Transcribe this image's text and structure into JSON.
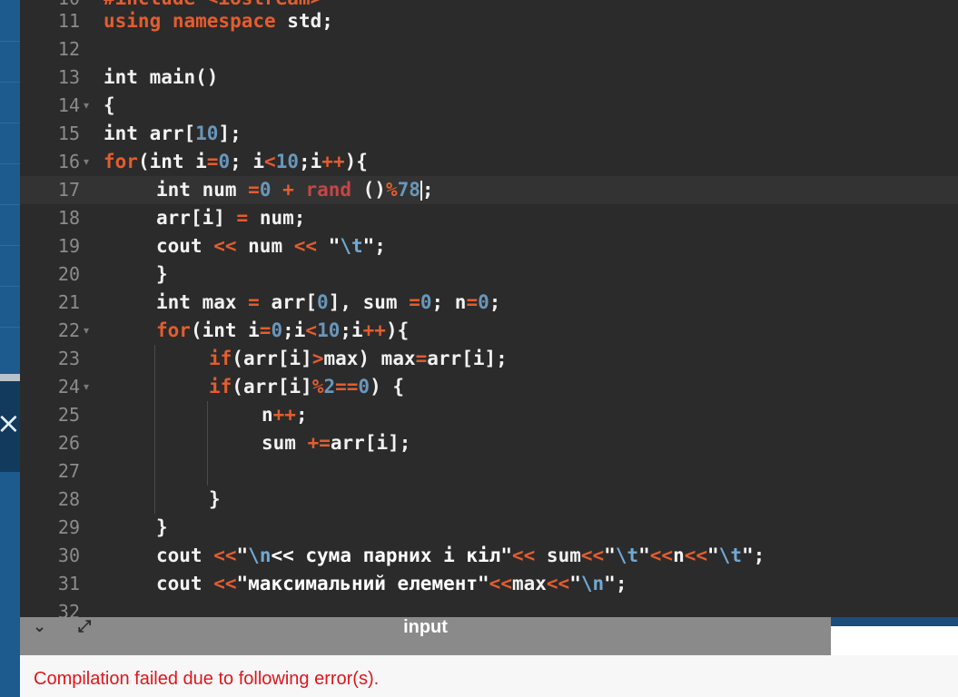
{
  "editor": {
    "top_partial_text": "#include <iostream>",
    "lines": [
      {
        "n": "11",
        "fold": "",
        "indent": 0,
        "tokens": [
          [
            "kw",
            "using namespace"
          ],
          [
            "id",
            " std;"
          ]
        ]
      },
      {
        "n": "12",
        "fold": "",
        "indent": 0,
        "tokens": []
      },
      {
        "n": "13",
        "fold": "",
        "indent": 0,
        "tokens": [
          [
            "id",
            "int main()"
          ]
        ]
      },
      {
        "n": "14",
        "fold": "▾",
        "indent": 0,
        "tokens": [
          [
            "id",
            "{"
          ]
        ]
      },
      {
        "n": "15",
        "fold": "",
        "indent": 0,
        "tokens": [
          [
            "id",
            "int arr["
          ],
          [
            "num",
            "10"
          ],
          [
            "id",
            "];"
          ]
        ]
      },
      {
        "n": "16",
        "fold": "▾",
        "indent": 0,
        "tokens": [
          [
            "kw",
            "for"
          ],
          [
            "id",
            "(int i"
          ],
          [
            "op",
            "="
          ],
          [
            "num",
            "0"
          ],
          [
            "id",
            "; i"
          ],
          [
            "op",
            "<"
          ],
          [
            "num",
            "10"
          ],
          [
            "id",
            ";i"
          ],
          [
            "op",
            "++"
          ],
          [
            "id",
            "){"
          ]
        ]
      },
      {
        "n": "17",
        "fold": "",
        "indent": 1,
        "active": true,
        "tokens": [
          [
            "id",
            "int num "
          ],
          [
            "op",
            "="
          ],
          [
            "num",
            "0"
          ],
          [
            "id",
            " "
          ],
          [
            "op",
            "+"
          ],
          [
            "id",
            " "
          ],
          [
            "fn",
            "rand"
          ],
          [
            "id",
            " ()"
          ],
          [
            "op",
            "%"
          ],
          [
            "num",
            "78"
          ],
          [
            "cursor",
            ""
          ],
          [
            "id",
            ";"
          ]
        ]
      },
      {
        "n": "18",
        "fold": "",
        "indent": 1,
        "tokens": [
          [
            "id",
            "arr[i] "
          ],
          [
            "op",
            "="
          ],
          [
            "id",
            " num;"
          ]
        ]
      },
      {
        "n": "19",
        "fold": "",
        "indent": 1,
        "tokens": [
          [
            "id",
            "cout "
          ],
          [
            "op",
            "<<"
          ],
          [
            "id",
            " num "
          ],
          [
            "op",
            "<<"
          ],
          [
            "id",
            " "
          ],
          [
            "str",
            "\""
          ],
          [
            "esc",
            "\\t"
          ],
          [
            "str",
            "\""
          ],
          [
            "id",
            ";"
          ]
        ]
      },
      {
        "n": "20",
        "fold": "",
        "indent": 1,
        "tokens": [
          [
            "id",
            "}"
          ]
        ]
      },
      {
        "n": "21",
        "fold": "",
        "indent": 1,
        "tokens": [
          [
            "id",
            "int max "
          ],
          [
            "op",
            "="
          ],
          [
            "id",
            " arr["
          ],
          [
            "num",
            "0"
          ],
          [
            "id",
            "], sum "
          ],
          [
            "op",
            "="
          ],
          [
            "num",
            "0"
          ],
          [
            "id",
            "; n"
          ],
          [
            "op",
            "="
          ],
          [
            "num",
            "0"
          ],
          [
            "id",
            ";"
          ]
        ]
      },
      {
        "n": "22",
        "fold": "▾",
        "indent": 1,
        "tokens": [
          [
            "kw",
            "for"
          ],
          [
            "id",
            "(int i"
          ],
          [
            "op",
            "="
          ],
          [
            "num",
            "0"
          ],
          [
            "id",
            ";i"
          ],
          [
            "op",
            "<"
          ],
          [
            "num",
            "10"
          ],
          [
            "id",
            ";i"
          ],
          [
            "op",
            "++"
          ],
          [
            "id",
            "){"
          ]
        ]
      },
      {
        "n": "23",
        "fold": "",
        "indent": 2,
        "tokens": [
          [
            "kw",
            "if"
          ],
          [
            "id",
            "(arr[i]"
          ],
          [
            "op",
            ">"
          ],
          [
            "id",
            "max) max"
          ],
          [
            "op",
            "="
          ],
          [
            "id",
            "arr[i];"
          ]
        ]
      },
      {
        "n": "24",
        "fold": "▾",
        "indent": 2,
        "tokens": [
          [
            "kw",
            "if"
          ],
          [
            "id",
            "(arr[i]"
          ],
          [
            "op",
            "%"
          ],
          [
            "num",
            "2"
          ],
          [
            "op",
            "=="
          ],
          [
            "num",
            "0"
          ],
          [
            "id",
            ") {"
          ]
        ]
      },
      {
        "n": "25",
        "fold": "",
        "indent": 3,
        "tokens": [
          [
            "id",
            "n"
          ],
          [
            "op",
            "++"
          ],
          [
            "id",
            ";"
          ]
        ]
      },
      {
        "n": "26",
        "fold": "",
        "indent": 3,
        "tokens": [
          [
            "id",
            "sum "
          ],
          [
            "op",
            "+="
          ],
          [
            "id",
            "arr[i];"
          ]
        ]
      },
      {
        "n": "27",
        "fold": "",
        "indent": 3,
        "tokens": []
      },
      {
        "n": "28",
        "fold": "",
        "indent": 2,
        "tokens": [
          [
            "id",
            "}"
          ]
        ]
      },
      {
        "n": "29",
        "fold": "",
        "indent": 1,
        "tokens": [
          [
            "id",
            "}"
          ]
        ]
      },
      {
        "n": "30",
        "fold": "",
        "indent": 1,
        "tokens": [
          [
            "id",
            "cout "
          ],
          [
            "op",
            "<<"
          ],
          [
            "str",
            "\""
          ],
          [
            "esc",
            "\\n"
          ],
          [
            "str",
            "<< сума парних і кіл\""
          ],
          [
            "op",
            "<<"
          ],
          [
            "id",
            " sum"
          ],
          [
            "op",
            "<<"
          ],
          [
            "str",
            "\""
          ],
          [
            "esc",
            "\\t"
          ],
          [
            "str",
            "\""
          ],
          [
            "op",
            "<<"
          ],
          [
            "id",
            "n"
          ],
          [
            "op",
            "<<"
          ],
          [
            "str",
            "\""
          ],
          [
            "esc",
            "\\t"
          ],
          [
            "str",
            "\""
          ],
          [
            "id",
            ";"
          ]
        ]
      },
      {
        "n": "31",
        "fold": "",
        "indent": 1,
        "tokens": [
          [
            "id",
            "cout "
          ],
          [
            "op",
            "<<"
          ],
          [
            "str",
            "\"максимальний елемент\""
          ],
          [
            "op",
            "<<"
          ],
          [
            "id",
            "max"
          ],
          [
            "op",
            "<<"
          ],
          [
            "str",
            "\""
          ],
          [
            "esc",
            "\\n"
          ],
          [
            "str",
            "\""
          ],
          [
            "id",
            ";"
          ]
        ]
      }
    ]
  },
  "panel": {
    "title": "input",
    "collapse_icon": "chevron-down-icon",
    "expand_icon": "expand-arrows-icon"
  },
  "output": {
    "error_text": "Compilation failed due to following error(s)."
  }
}
